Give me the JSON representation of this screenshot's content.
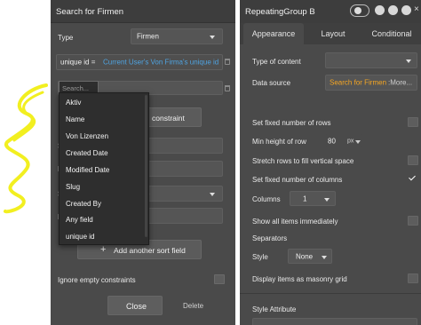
{
  "left_panel": {
    "title": "Search for Firmen",
    "type_label": "Type",
    "type_value": "Firmen",
    "constraint_key": "unique id =",
    "constraint_value": "Current User's Von Firma's unique id",
    "search_placeholder": "Search...",
    "add_constraint_label": "constraint",
    "add_sort_label": "Add another sort field",
    "ignore_empty_label": "Ignore empty constraints",
    "close_label": "Close",
    "delete_label": "Delete",
    "dropdown_items": [
      "Aktiv",
      "Name",
      "Von Lizenzen",
      "Created Date",
      "Modified Date",
      "Slug",
      "Created By",
      "Any field",
      "unique id"
    ],
    "partial_row_value": "e",
    "partial_row_value2": "k"
  },
  "right_panel": {
    "title": "RepeatingGroup B",
    "tabs": [
      "Appearance",
      "Layout",
      "Conditional"
    ],
    "type_of_content_label": "Type of content",
    "data_source_label": "Data source",
    "data_source_value": "Search for Firmens",
    "data_source_more": ":More...",
    "fixed_rows_label": "Set fixed number of rows",
    "min_height_label": "Min height of row",
    "min_height_value": "80",
    "min_height_unit": "px",
    "stretch_label": "Stretch rows to fill vertical space",
    "fixed_columns_label": "Set fixed number of columns",
    "columns_label": "Columns",
    "columns_value": "1",
    "show_all_label": "Show all items immediately",
    "separators_label": "Separators",
    "style_label": "Style",
    "style_value": "None",
    "masonry_label": "Display items as masonry grid",
    "style_attr_label": "Style Attribute"
  },
  "colors": {
    "panel_bg": "#4a4a4a",
    "title_bg": "#3d3d3d",
    "data_source_text": "#f5a623",
    "link_blue": "#4fa3e0",
    "scribble": "#f2ef20"
  }
}
